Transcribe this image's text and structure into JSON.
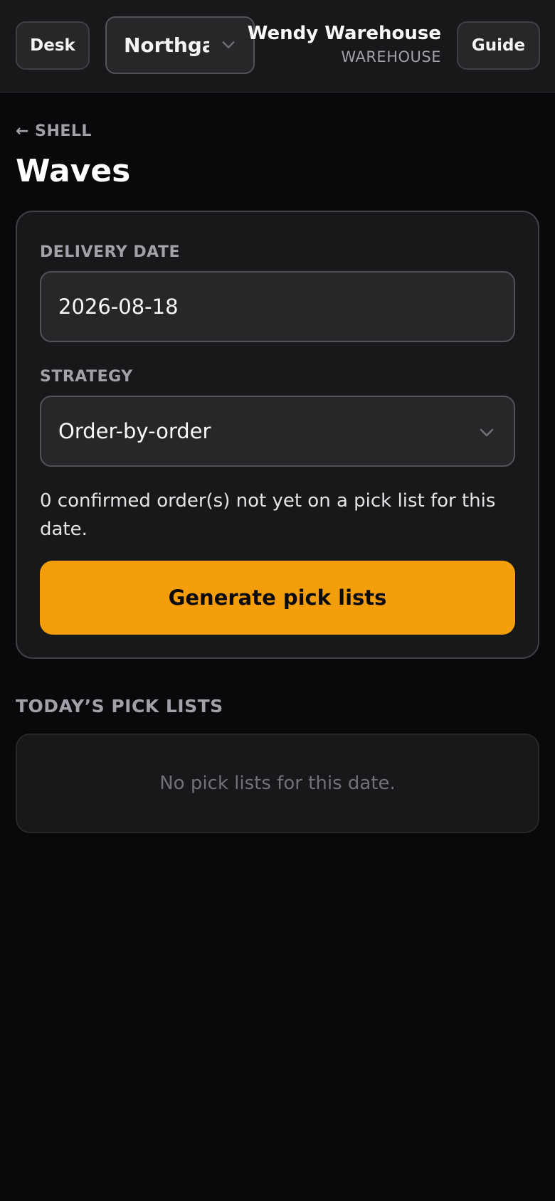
{
  "header": {
    "desk_label": "Desk",
    "site_select": {
      "value": "Northgate",
      "icon": "chevron-down-icon"
    },
    "user_name": "Wendy Warehouse",
    "user_role": "WAREHOUSE",
    "guide_label": "Guide"
  },
  "page": {
    "back_link": "← SHELL",
    "title": "Waves"
  },
  "form": {
    "delivery_date_label": "DELIVERY DATE",
    "delivery_date_value": "2026-08-18",
    "strategy_label": "STRATEGY",
    "strategy_value": "Order-by-order",
    "info": "0 confirmed order(s) not yet on a pick list for this date.",
    "generate_label": "Generate pick lists"
  },
  "pick_lists": {
    "heading": "TODAY’S PICK LISTS",
    "empty_text": "No pick lists for this date."
  },
  "colors": {
    "background": "#09090b",
    "surface": "#18181b",
    "accent": "#f59e0b"
  }
}
